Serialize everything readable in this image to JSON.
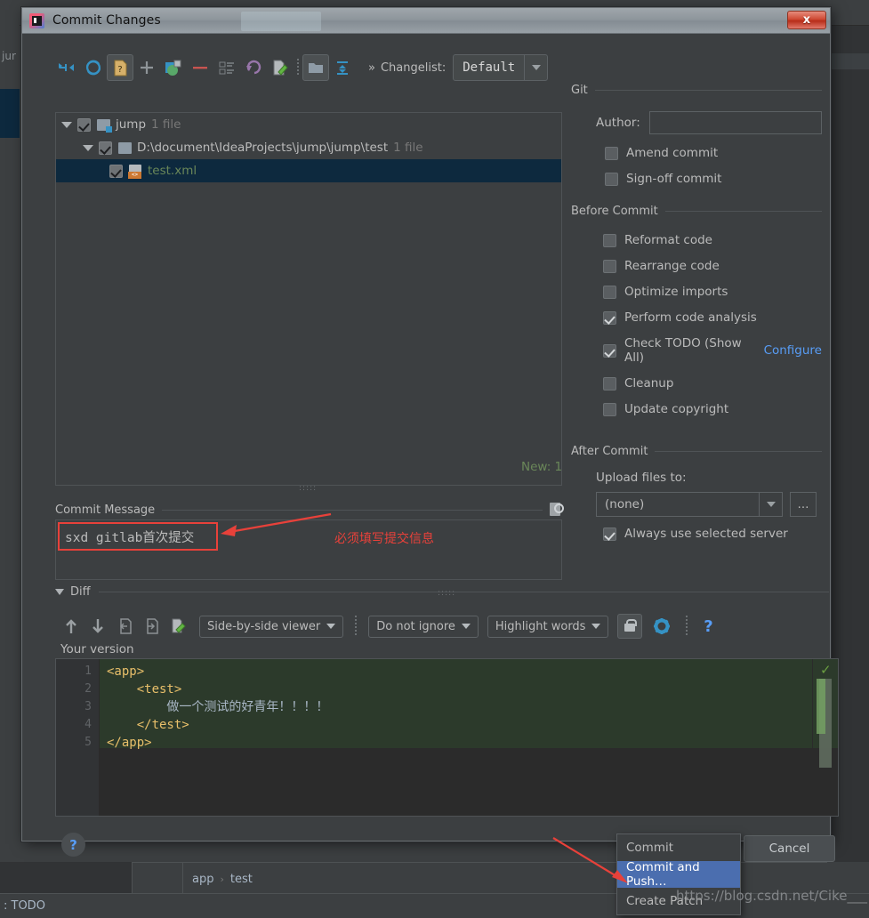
{
  "window": {
    "title": "Commit Changes",
    "close_label": "x",
    "app_icon": "intellij-idea-icon"
  },
  "toolbar": {
    "icons": [
      {
        "name": "show-diff-icon",
        "glyph": "arrows"
      },
      {
        "name": "refresh-icon",
        "glyph": "refresh"
      },
      {
        "name": "unversioned-files-icon",
        "glyph": "question-doc"
      },
      {
        "name": "add-icon",
        "glyph": "plus"
      },
      {
        "name": "move-to-changelist-icon",
        "glyph": "move"
      },
      {
        "name": "delete-icon",
        "glyph": "minus"
      },
      {
        "name": "group-by-icon",
        "glyph": "list"
      },
      {
        "name": "rollback-icon",
        "glyph": "undo"
      },
      {
        "name": "edit-source-icon",
        "glyph": "edit"
      },
      {
        "name": "group-by-directory-icon",
        "glyph": "folder"
      },
      {
        "name": "expand-collapse-icon",
        "glyph": "collapse"
      }
    ],
    "expand_label": "»",
    "changelist_label": "Changelist:",
    "changelist_value": "Default"
  },
  "tree": {
    "rows": [
      {
        "name": "jump",
        "count": "1 file",
        "icon": "folder-modified-icon",
        "checked": true,
        "expanded": true,
        "level": 1,
        "selected": false
      },
      {
        "name": "D:\\document\\IdeaProjects\\jump\\jump\\test",
        "count": "1 file",
        "icon": "folder-icon",
        "checked": true,
        "expanded": true,
        "level": 2,
        "selected": false
      },
      {
        "name": "test.xml",
        "count": "",
        "icon": "xml-file-icon",
        "checked": true,
        "expanded": null,
        "level": 3,
        "selected": true
      }
    ],
    "new_count": "New: 1"
  },
  "commit_message": {
    "label": "Commit Message",
    "value": "sxd gitlab首次提交",
    "history_icon": "message-history-icon",
    "annotation": "必须填写提交信息"
  },
  "git_panel": {
    "title": "Git",
    "author_label": "Author:",
    "author_value": "",
    "checkboxes": [
      {
        "label": "Amend commit",
        "checked": false,
        "name": "amend-commit-checkbox"
      },
      {
        "label": "Sign-off commit",
        "checked": false,
        "name": "sign-off-commit-checkbox"
      }
    ]
  },
  "before_commit": {
    "title": "Before Commit",
    "checkboxes": [
      {
        "label": "Reformat code",
        "checked": false,
        "name": "reformat-code-checkbox"
      },
      {
        "label": "Rearrange code",
        "checked": false,
        "name": "rearrange-code-checkbox"
      },
      {
        "label": "Optimize imports",
        "checked": false,
        "name": "optimize-imports-checkbox"
      },
      {
        "label": "Perform code analysis",
        "checked": true,
        "name": "perform-code-analysis-checkbox"
      },
      {
        "label": "Check TODO (Show All)",
        "checked": true,
        "name": "check-todo-checkbox",
        "link": "Configure"
      },
      {
        "label": "Cleanup",
        "checked": false,
        "name": "cleanup-checkbox"
      },
      {
        "label": "Update copyright",
        "checked": false,
        "name": "update-copyright-checkbox"
      }
    ]
  },
  "after_commit": {
    "title": "After Commit",
    "upload_label": "Upload files to:",
    "upload_value": "(none)",
    "browse_label": "…",
    "always_use_label": "Always use selected server",
    "always_use_checked": true
  },
  "diff": {
    "title": "Diff",
    "toolbar_icons": [
      {
        "name": "previous-difference-icon"
      },
      {
        "name": "next-difference-icon"
      },
      {
        "name": "accept-left-icon"
      },
      {
        "name": "accept-right-icon"
      },
      {
        "name": "edit-source-icon"
      }
    ],
    "viewer_mode": "Side-by-side viewer",
    "ignore_mode": "Do not ignore",
    "highlight_mode": "Highlight words",
    "lock_icon": "lock-icon",
    "settings_icon": "gear-icon",
    "help_icon": "question-icon",
    "pane_label": "Your version",
    "code_lines": [
      {
        "num": "1",
        "text": "<app>"
      },
      {
        "num": "2",
        "text": "    <test>"
      },
      {
        "num": "3",
        "text": "        做一个测试的好青年！！！！"
      },
      {
        "num": "4",
        "text": "    </test>"
      },
      {
        "num": "5",
        "text": "</app>"
      }
    ]
  },
  "footer": {
    "help_label": "?",
    "commit_label": "Commit",
    "cancel_label": "Cancel",
    "menu_items": [
      {
        "label": "Commit",
        "highlighted": false,
        "name": "menu-item-commit"
      },
      {
        "label": "Commit and Push…",
        "highlighted": true,
        "name": "menu-item-commit-and-push"
      },
      {
        "label": "Create Patch",
        "highlighted": false,
        "name": "menu-item-create-patch"
      }
    ]
  },
  "ide": {
    "left_label": "jur",
    "breadcrumb": [
      "app",
      "test"
    ],
    "breadcrumb_sep": "›",
    "status_text": ": TODO",
    "watermark": "https://blog.csdn.net/Cike___"
  },
  "colors": {
    "accent_blue": "#589df6",
    "selection_blue": "#0d293e",
    "menu_highlight": "#4b6eaf",
    "green_text": "#6a8759",
    "annotation_red": "#e8413a"
  }
}
